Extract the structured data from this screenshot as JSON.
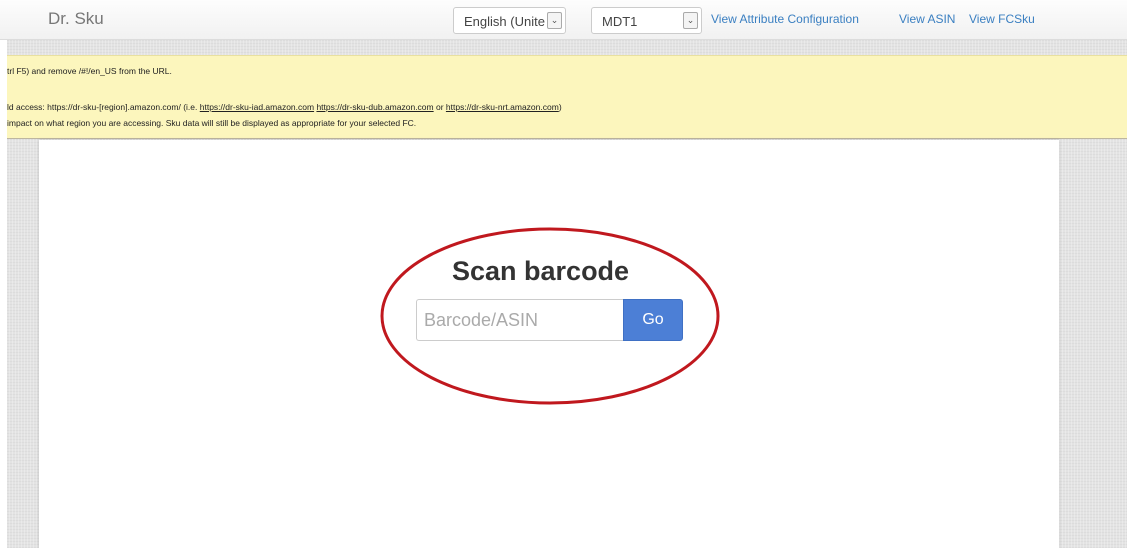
{
  "navbar": {
    "brand": "Dr. Sku",
    "language_select": {
      "value": "English (Unite"
    },
    "fc_select": {
      "value": "MDT1"
    },
    "links": [
      {
        "label": "View Attribute Configuration"
      },
      {
        "label": "View ASIN"
      },
      {
        "label": "View FCSku"
      }
    ]
  },
  "notice": {
    "line1": "trl F5) and remove /#!/en_US from the URL.",
    "line2_prefix": "ld access: https://dr-sku-[region].amazon.com/ (i.e. ",
    "line2_link1": "https://dr-sku-iad.amazon.com",
    "line2_link2": "https://dr-sku-dub.amazon.com",
    "line2_or": " or ",
    "line2_link3": "https://dr-sku-nrt.amazon.com",
    "line2_suffix": ")",
    "line3": "impact on what region you are accessing. Sku data will still be displayed as appropriate for your selected FC."
  },
  "scan": {
    "title": "Scan barcode",
    "input_placeholder": "Barcode/ASIN",
    "input_value": "",
    "go_label": "Go"
  },
  "colors": {
    "link": "#3a7fc1",
    "go_button": "#4c7fd6",
    "notice_bg": "#fcf6bd",
    "annotation": "#c0181e"
  }
}
